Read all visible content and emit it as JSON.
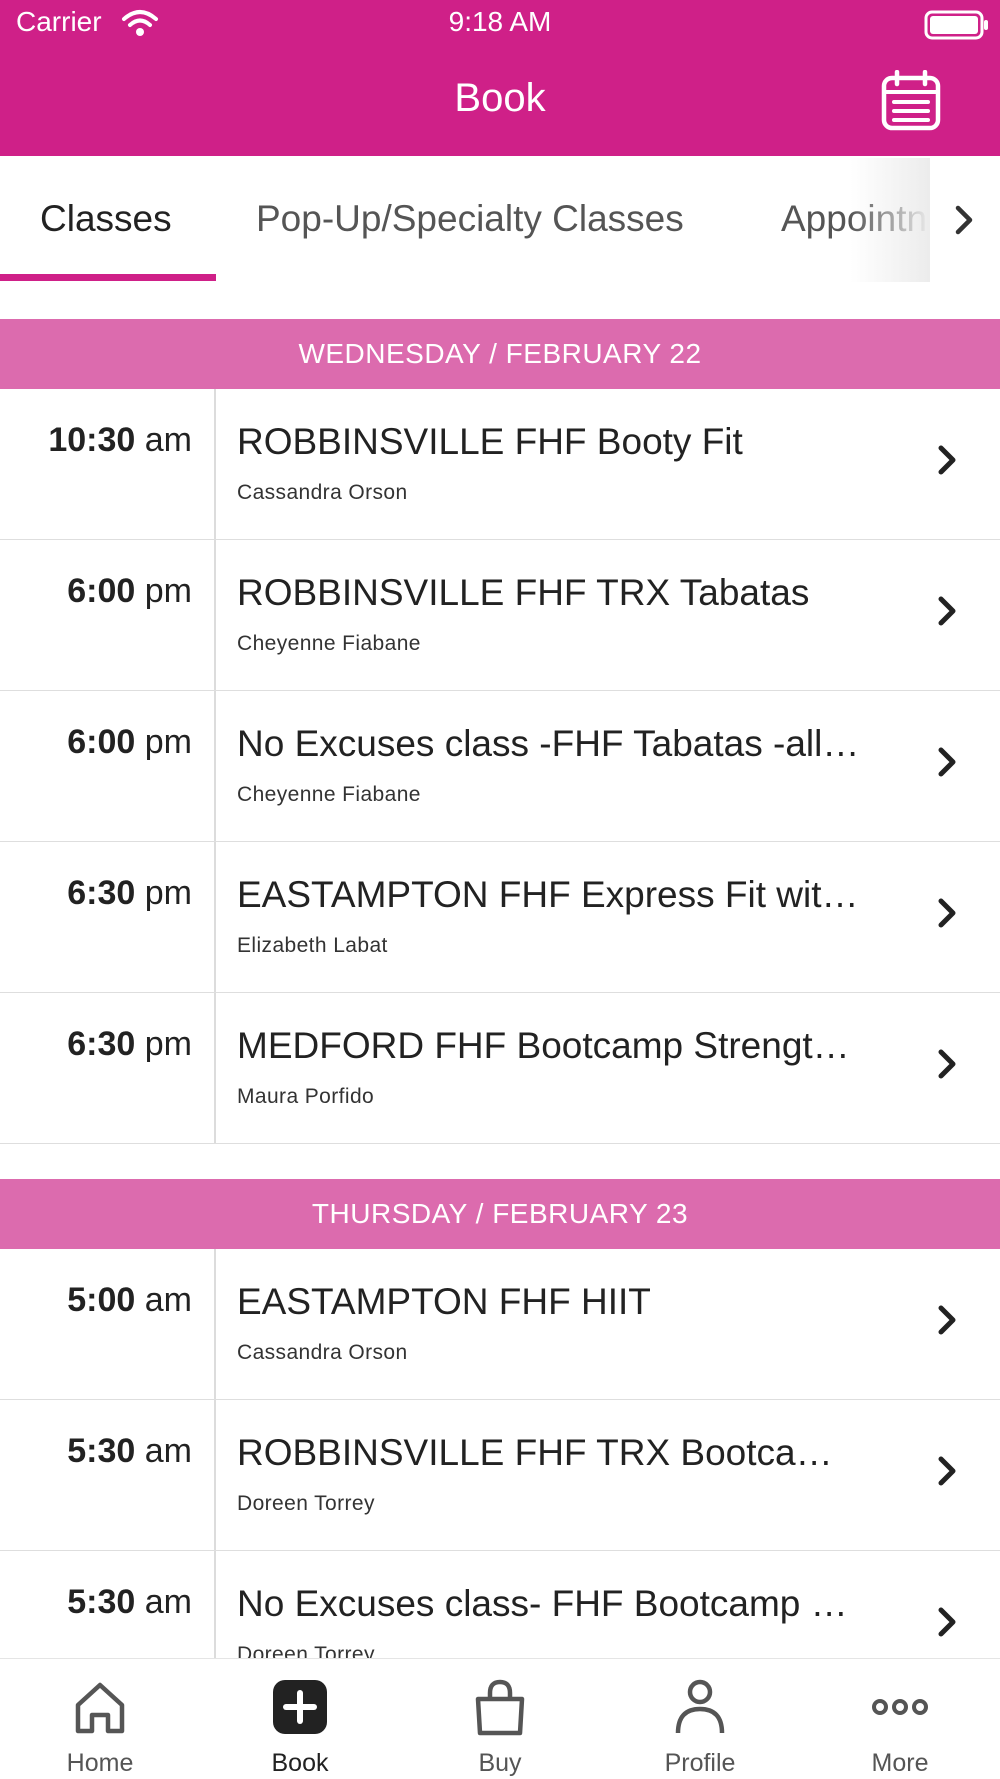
{
  "status_bar": {
    "carrier": "Carrier",
    "time": "9:18 AM"
  },
  "nav": {
    "title": "Book",
    "calendar_icon": "calendar-icon"
  },
  "tabs": [
    {
      "label": "Classes",
      "active": true
    },
    {
      "label": "Pop-Up/Specialty Classes",
      "active": false
    },
    {
      "label": "Appointn",
      "active": false
    }
  ],
  "days": [
    {
      "header": "WEDNESDAY / FEBRUARY 22",
      "classes": [
        {
          "time": "10:30",
          "ampm": "am",
          "name": "ROBBINSVILLE FHF Booty Fit",
          "instructor": "Cassandra Orson"
        },
        {
          "time": "6:00",
          "ampm": "pm",
          "name": "ROBBINSVILLE FHF TRX Tabatas",
          "instructor": "Cheyenne Fiabane"
        },
        {
          "time": "6:00",
          "ampm": "pm",
          "name": "No Excuses class -FHF Tabatas -all…",
          "instructor": "Cheyenne Fiabane"
        },
        {
          "time": "6:30",
          "ampm": "pm",
          "name": "EASTAMPTON FHF Express Fit wit…",
          "instructor": "Elizabeth Labat"
        },
        {
          "time": "6:30",
          "ampm": "pm",
          "name": "MEDFORD FHF Bootcamp Strengt…",
          "instructor": "Maura Porfido"
        }
      ]
    },
    {
      "header": "THURSDAY / FEBRUARY 23",
      "classes": [
        {
          "time": "5:00",
          "ampm": "am",
          "name": "EASTAMPTON FHF HIIT",
          "instructor": "Cassandra Orson"
        },
        {
          "time": "5:30",
          "ampm": "am",
          "name": "ROBBINSVILLE FHF TRX Bootca…",
          "instructor": "Doreen Torrey"
        },
        {
          "time": "5:30",
          "ampm": "am",
          "name": "No Excuses class- FHF Bootcamp …",
          "instructor": "Doreen Torrey"
        }
      ]
    }
  ],
  "tab_bar": [
    {
      "label": "Home",
      "icon": "home-icon"
    },
    {
      "label": "Book",
      "icon": "book-plus-icon",
      "active": true
    },
    {
      "label": "Buy",
      "icon": "shopping-bag-icon"
    },
    {
      "label": "Profile",
      "icon": "profile-icon"
    },
    {
      "label": "More",
      "icon": "more-icon"
    }
  ],
  "colors": {
    "brand": "#cf2088",
    "date_header": "#dc6bae"
  }
}
